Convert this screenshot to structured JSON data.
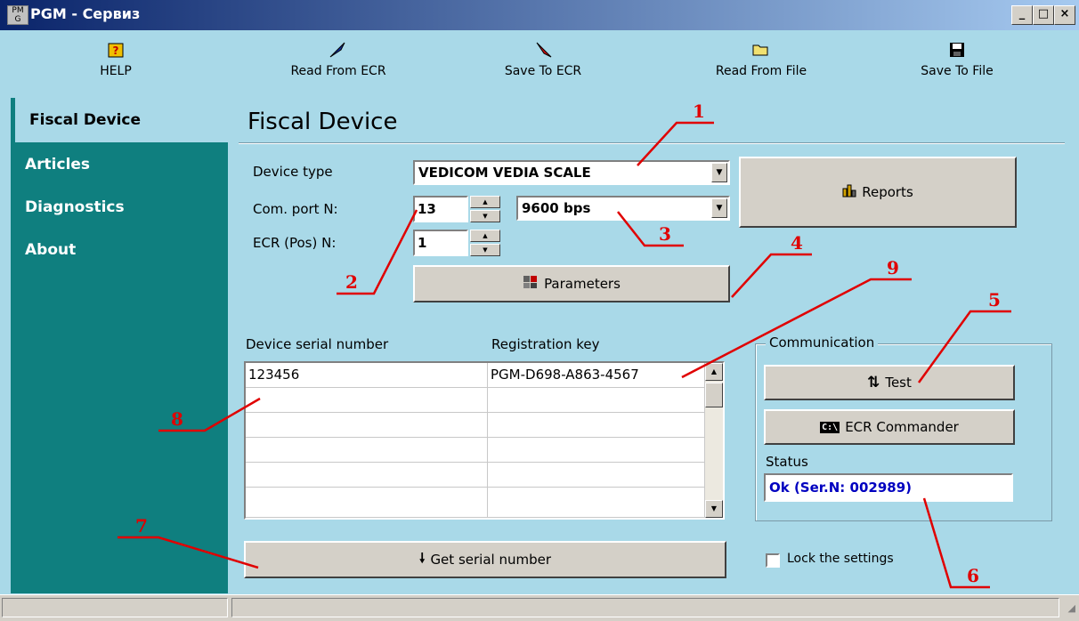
{
  "window": {
    "icon_text": "PM\nG",
    "title": "PGM - Сервиз",
    "controls": {
      "minimize": "_",
      "maximize": "□",
      "close": "×"
    }
  },
  "toolbar": {
    "items": [
      {
        "label": "HELP",
        "icon": "help-book-icon"
      },
      {
        "label": "Read From ECR",
        "icon": "blue-arrow-icon"
      },
      {
        "label": "Save To ECR",
        "icon": "red-arrow-icon"
      },
      {
        "label": "Read From File",
        "icon": "open-folder-icon"
      },
      {
        "label": "Save To File",
        "icon": "floppy-disk-icon"
      }
    ]
  },
  "sidebar": {
    "items": [
      {
        "label": "Fiscal Device",
        "active": true
      },
      {
        "label": "Articles"
      },
      {
        "label": "Diagnostics"
      },
      {
        "label": "About"
      }
    ]
  },
  "main": {
    "title": "Fiscal Device",
    "device_type_label": "Device type",
    "device_type_value": "VEDICOM VEDIA SCALE",
    "com_port_label": "Com. port N:",
    "com_port_value": "13",
    "baud_value": "9600 bps",
    "ecr_label": "ECR (Pos) N:",
    "ecr_value": "1",
    "reports_button": "Reports",
    "parameters_button": "Parameters",
    "serial_header": "Device serial number",
    "regkey_header": "Registration key",
    "rows": [
      {
        "serial": "123456",
        "key": "PGM-D698-A863-4567"
      },
      {
        "serial": "",
        "key": ""
      },
      {
        "serial": "",
        "key": ""
      },
      {
        "serial": "",
        "key": ""
      },
      {
        "serial": "",
        "key": ""
      },
      {
        "serial": "",
        "key": ""
      }
    ],
    "get_serial_button": "Get serial number",
    "communication_title": "Communication",
    "test_button": "Test",
    "ecr_commander_button": "ECR Commander",
    "ecr_commander_icon_text": "C:\\",
    "status_label": "Status",
    "status_value": "Ok (Ser.N: 002989)",
    "lock_label": "Lock the settings",
    "lock_checked": false
  },
  "annotations": [
    "1",
    "2",
    "3",
    "4",
    "5",
    "6",
    "7",
    "8",
    "9"
  ],
  "colors": {
    "accent_red": "#e00000",
    "sidebar_teal": "#0f7f7f",
    "background": "#a9d9e8",
    "status_blue": "#0000c0"
  }
}
